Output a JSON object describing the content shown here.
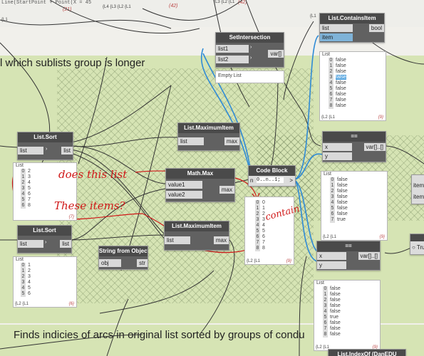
{
  "top_fragments": {
    "code_line": "Line(StartPoint + Point(X = 45",
    "count_21": "(21)",
    "lvl_a": "{L1",
    "lvl_b": "{L4 {L3 {L2 {L1",
    "count_42a": "(42)",
    "lvl_c": "{L3 {L2 {L1",
    "count_42b": "(42)",
    "lvl_d": "{L1"
  },
  "groups": {
    "title_1": "l which sublists group is longer",
    "title_2": "Finds indicies of arcs in original list sorted by groups of condu"
  },
  "nodes": {
    "set_intersection": {
      "title": "SetIntersection",
      "in1": "list1",
      "in2": "list2",
      "out": "var[]",
      "preview": "Empty List"
    },
    "contains_item": {
      "title": "List.ContainsItem",
      "in1": "list",
      "in2": "item",
      "out": "bool",
      "preview_header": "List",
      "items": [
        "false",
        "false",
        "false",
        "false",
        "false",
        "false",
        "false",
        "false",
        "false"
      ],
      "foot": "{L2 {L1",
      "count": "{9}"
    },
    "list_sort_1": {
      "title": "List.Sort",
      "in": "list",
      "out": "list",
      "preview_header": "List",
      "items": [
        "2",
        "3",
        "4",
        "5",
        "6",
        "7",
        "8"
      ],
      "idx": [
        "0",
        "1",
        "2",
        "3",
        "4",
        "5",
        "6"
      ],
      "foot": "{L2 {L1",
      "count": "{7}"
    },
    "maximum_item_1": {
      "title": "List.MaximumItem",
      "in": "list",
      "out": "max"
    },
    "math_max": {
      "title": "Math.Max",
      "in1": "value1",
      "in2": "value2",
      "out": "max"
    },
    "code_block": {
      "title": "Code Block",
      "code": "0..n..1;",
      "in": "n",
      "out": ">",
      "preview_items": [
        "0",
        "1",
        "2",
        "3",
        "4",
        "5",
        "6",
        "7",
        "8"
      ],
      "foot": "{L2 {L1",
      "count": "{9}"
    },
    "equals_1": {
      "title": "==",
      "in1": "x",
      "in2": "y",
      "out": "var[]..[]",
      "preview_header": "List",
      "items": [
        "false",
        "false",
        "false",
        "false",
        "false",
        "false",
        "false",
        "true"
      ],
      "foot": "{L2 {L1",
      "count": "{9}"
    },
    "list_sort_2": {
      "title": "List.Sort",
      "in": "list",
      "out": "list",
      "preview_header": "List",
      "items": [
        "1",
        "2",
        "3",
        "4",
        "5",
        "6"
      ],
      "idx": [
        "0",
        "1",
        "2",
        "3",
        "4",
        "5"
      ],
      "foot": "{L2 {L1",
      "count": "{6}"
    },
    "maximum_item_2": {
      "title": "List.MaximumItem",
      "in": "list",
      "out": "max"
    },
    "string_from_object": {
      "title": "String from Object",
      "in": "obj",
      "out": "str"
    },
    "equals_2": {
      "title": "==",
      "in1": "x",
      "in2": "y",
      "out": "var[]..[]",
      "preview_header": "List",
      "items": [
        "false",
        "false",
        "false",
        "false",
        "false",
        "true",
        "false",
        "false",
        "false"
      ],
      "foot": "{L2 {L1",
      "count": "{9}"
    },
    "index_of": {
      "title": "List.IndexOf (DanEDU"
    },
    "right_partial": {
      "port1": "item",
      "port2": "item"
    },
    "boolean": {
      "label": "True"
    }
  },
  "annotations": {
    "a1": "does this list",
    "a2": "These items?",
    "a3": "contain"
  }
}
